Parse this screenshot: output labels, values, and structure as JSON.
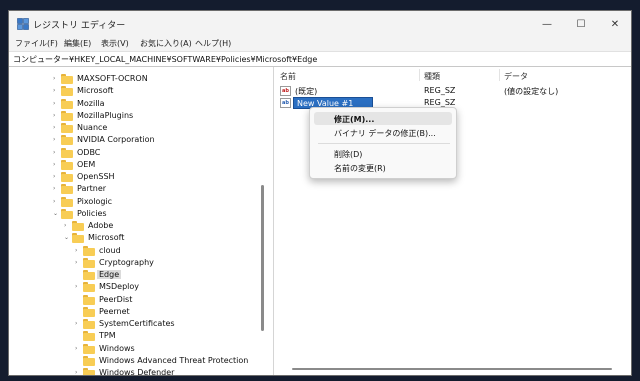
{
  "window": {
    "title": "レジストリ エディター"
  },
  "title_buttons": {
    "minimize": "—",
    "maximize": "☐",
    "close": "✕"
  },
  "menu": [
    "ファイル(F)",
    "編集(E)",
    "表示(V)",
    "お気に入り(A)",
    "ヘルプ(H)"
  ],
  "address": "コンピューター¥HKEY_LOCAL_MACHINE¥SOFTWARE¥Policies¥Microsoft¥Edge",
  "tree": [
    {
      "label": "MAXSOFT-OCRON",
      "twisty": "›"
    },
    {
      "label": "Microsoft",
      "twisty": "›"
    },
    {
      "label": "Mozilla",
      "twisty": "›"
    },
    {
      "label": "MozillaPlugins",
      "twisty": "›"
    },
    {
      "label": "Nuance",
      "twisty": "›"
    },
    {
      "label": "NVIDIA Corporation",
      "twisty": "›"
    },
    {
      "label": "ODBC",
      "twisty": "›"
    },
    {
      "label": "OEM",
      "twisty": "›"
    },
    {
      "label": "OpenSSH",
      "twisty": "›"
    },
    {
      "label": "Partner",
      "twisty": "›"
    },
    {
      "label": "Pixologic",
      "twisty": "›"
    },
    {
      "label": "Policies",
      "twisty": "⌄"
    },
    {
      "label": "Adobe",
      "twisty": "›"
    },
    {
      "label": "Microsoft",
      "twisty": "⌄"
    },
    {
      "label": "cloud",
      "twisty": "›"
    },
    {
      "label": "Cryptography",
      "twisty": "›"
    },
    {
      "label": "Edge",
      "twisty": "",
      "selected": true
    },
    {
      "label": "MSDeploy",
      "twisty": "›"
    },
    {
      "label": "PeerDist",
      "twisty": ""
    },
    {
      "label": "Peernet",
      "twisty": ""
    },
    {
      "label": "SystemCertificates",
      "twisty": "›"
    },
    {
      "label": "TPM",
      "twisty": ""
    },
    {
      "label": "Windows",
      "twisty": "›"
    },
    {
      "label": "Windows Advanced Threat Protection",
      "twisty": ""
    },
    {
      "label": "Windows Defender",
      "twisty": "›"
    }
  ],
  "columns": {
    "name": "名前",
    "type": "種類",
    "data": "データ"
  },
  "values": [
    {
      "name": "(既定)",
      "type": "REG_SZ",
      "data": "(値の設定なし)",
      "icon": "ab"
    },
    {
      "name": "New Value #1",
      "type": "REG_SZ",
      "data": "",
      "icon": "ab",
      "editing": true
    }
  ],
  "context_menu": [
    {
      "label": "修正(M)...",
      "bold": true,
      "hover": true
    },
    {
      "label": "バイナリ データの修正(B)..."
    },
    {
      "label": "削除(D)"
    },
    {
      "label": "名前の変更(R)"
    }
  ],
  "colors": {
    "folder": "#f8cd55",
    "selection": "#2b6fc2",
    "menu_hover": "#e5e5e5"
  }
}
